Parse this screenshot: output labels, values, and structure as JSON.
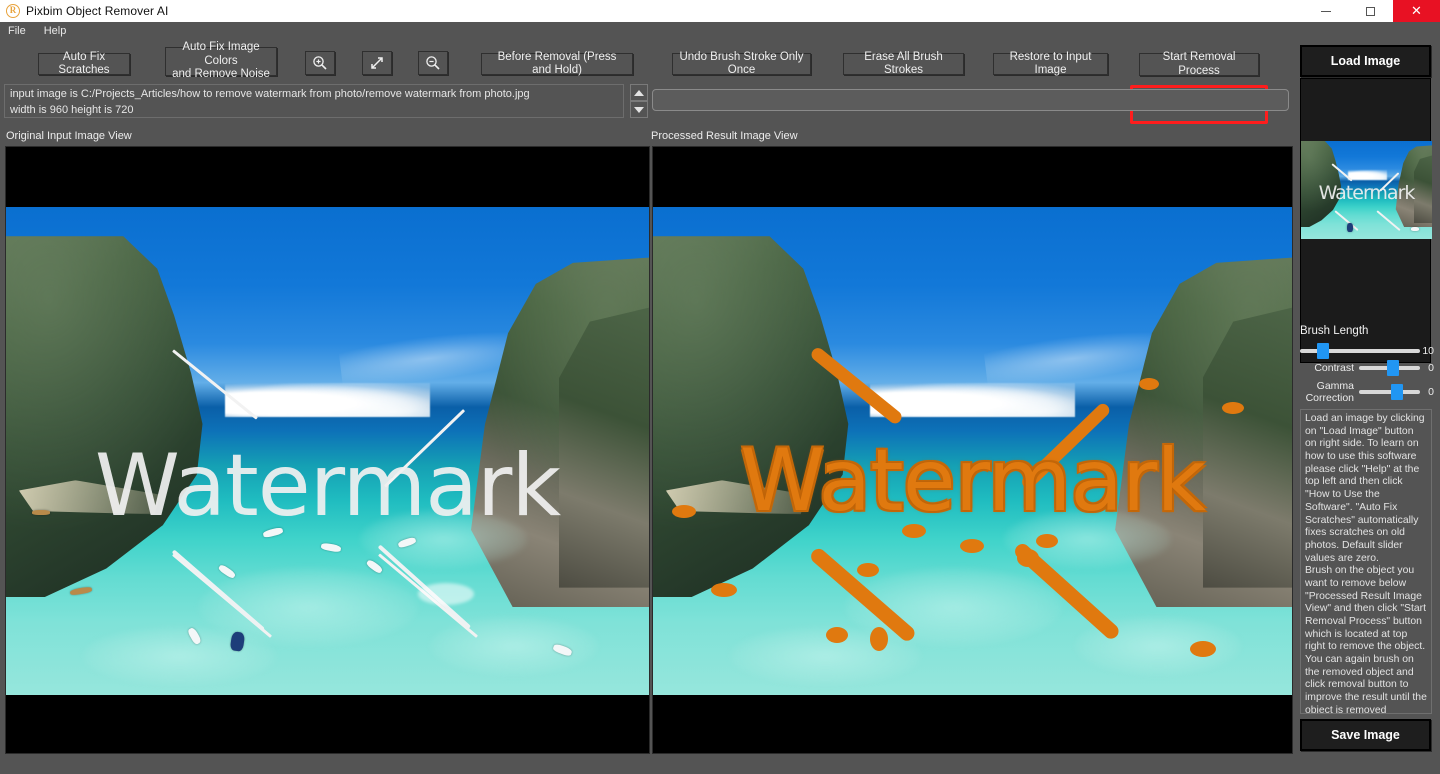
{
  "window": {
    "title": "Pixbim Object Remover AI",
    "app_icon": "pixbim-logo-icon",
    "minimize_label": "Minimize",
    "maximize_label": "Maximize",
    "close_label": "Close",
    "close_color": "#e81123",
    "titlebar_bg": "#ffffff",
    "chrome_bg": "#545454"
  },
  "menubar": {
    "items": [
      {
        "label": "File"
      },
      {
        "label": "Help"
      }
    ]
  },
  "toolbar": {
    "auto_fix_scratches": "Auto Fix Scratches",
    "auto_fix_colors_line1": "Auto Fix Image Colors",
    "auto_fix_colors_line2": "and Remove Noise",
    "zoom_in_icon": "zoom-in-icon",
    "fit_screen_icon": "fit-to-screen-icon",
    "zoom_out_icon": "zoom-out-icon",
    "before_removal": "Before Removal (Press and Hold)",
    "undo_brush_stroke": "Undo Brush Stroke Only Once",
    "erase_all_strokes": "Erase All Brush Strokes",
    "restore_input": "Restore to Input Image",
    "start_removal": "Start Removal Process",
    "start_removal_highlight_color": "#ff1d1d"
  },
  "info": {
    "line1": "input image is C:/Projects_Articles/how to remove watermark from photo/remove watermark from photo.jpg",
    "line2": "width is 960 height is 720",
    "spinner_up_icon": "triangle-up-icon",
    "spinner_down_icon": "triangle-down-icon",
    "progress_value": ""
  },
  "views": {
    "original_label": "Original Input Image View",
    "processed_label": "Processed Result Image View",
    "watermark_text": "Watermark",
    "brush_color": "#e0790f"
  },
  "sidebar": {
    "load_image": "Load Image",
    "save_image": "Save Image",
    "brush_length_label": "Brush Length",
    "sliders": [
      {
        "label": "Brush Length",
        "value": "10",
        "position": 14
      },
      {
        "label": "Contrast",
        "value": "0",
        "position": 50
      },
      {
        "label_line1": "Gamma",
        "label_line2": "Correction",
        "label": "Gamma Correction",
        "value": "0",
        "position": 56
      }
    ],
    "help_text": "Load an image by clicking on \"Load Image\" button on right side. To learn on how to use this software please click \"Help\" at the top left and then click \"How to Use the Software\". \"Auto Fix Scratches\" automatically fixes scratches on old photos. Default slider values are zero.\nBrush on the object you want to remove below \"Processed Result Image View\" and then click \"Start Removal Process\" button which is located at top right to remove the object.\n You can again brush on the removed object and click removal button to improve the result until the object is removed completely.\npixbim.com",
    "accent_color": "#2196f3"
  }
}
